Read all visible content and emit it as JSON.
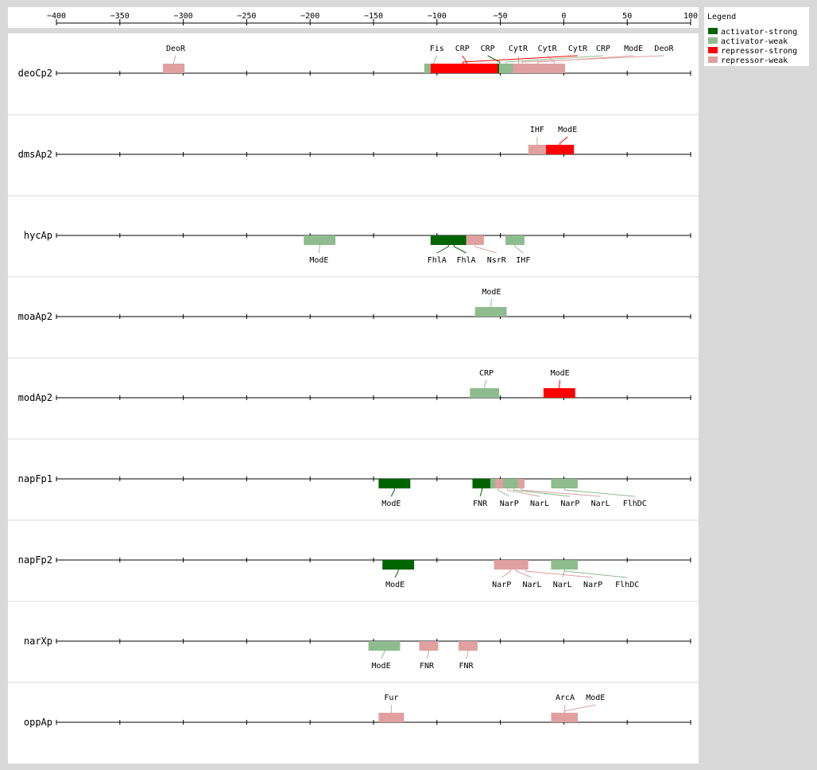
{
  "chart_data": {
    "type": "promoter-map",
    "axis": {
      "min": -400,
      "max": 100,
      "ticks": [
        -400,
        -350,
        -300,
        -250,
        -200,
        -150,
        -100,
        -50,
        0,
        50,
        100
      ],
      "tick_labels": [
        "−400",
        "−350",
        "−300",
        "−250",
        "−200",
        "−150",
        "−100",
        "−50",
        "0",
        "50",
        "100"
      ]
    },
    "colors": {
      "activator-strong": "#006400",
      "activator-weak": "#8fbc8f",
      "repressor-strong": "#ff0000",
      "repressor-weak": "#e0a0a0"
    },
    "legend": {
      "title": "Legend",
      "items": [
        {
          "key": "activator-strong",
          "label": "activator-strong"
        },
        {
          "key": "activator-weak",
          "label": "activator-weak"
        },
        {
          "key": "repressor-strong",
          "label": "repressor-strong"
        },
        {
          "key": "repressor-weak",
          "label": "repressor-weak"
        }
      ]
    },
    "tracks": [
      {
        "name": "deoCp2",
        "sites": [
          {
            "name": "DeoR",
            "start": -316,
            "end": -299,
            "type": "repressor-weak",
            "side": "above",
            "label_x": -306
          },
          {
            "name": "Fis",
            "start": -110,
            "end": -95,
            "type": "activator-weak",
            "side": "above",
            "label_x": -100
          },
          {
            "name": "CRP",
            "start": -105,
            "end": -48,
            "type": "repressor-strong",
            "side": "above",
            "label_x": -80
          },
          {
            "name": "CRP",
            "start": -52,
            "end": -49,
            "type": "activator-strong",
            "side": "above",
            "label_x": -60
          },
          {
            "name": "CytR",
            "start": -49,
            "end": -22,
            "type": "repressor-weak",
            "side": "above",
            "label_x": -36
          },
          {
            "name": "CytR",
            "start": -16,
            "end": 1,
            "type": "repressor-weak",
            "side": "above",
            "label_x": -13
          },
          {
            "name": "CytR",
            "start": -97,
            "end": -62,
            "type": "repressor-strong",
            "side": "above",
            "label_x": 11
          },
          {
            "name": "CRP",
            "start": -51,
            "end": -40,
            "type": "activator-weak",
            "side": "above",
            "label_x": 31
          },
          {
            "name": "ModE",
            "start": -30,
            "end": -11,
            "type": "repressor-weak",
            "side": "above",
            "label_x": 55
          },
          {
            "name": "DeoR",
            "start": -40,
            "end": -25,
            "type": "repressor-weak",
            "side": "above",
            "label_x": 79
          }
        ]
      },
      {
        "name": "dmsAp2",
        "sites": [
          {
            "name": "IHF",
            "start": -28,
            "end": -14,
            "type": "repressor-weak",
            "side": "above",
            "label_x": -21
          },
          {
            "name": "ModE",
            "start": -14,
            "end": 8,
            "type": "repressor-strong",
            "side": "above",
            "label_x": 3
          }
        ]
      },
      {
        "name": "hycAp",
        "sites": [
          {
            "name": "ModE",
            "start": -205,
            "end": -180,
            "type": "activator-weak",
            "side": "below",
            "label_x": -193
          },
          {
            "name": "FhlA",
            "start": -105,
            "end": -77,
            "type": "activator-strong",
            "side": "below",
            "label_x": -100
          },
          {
            "name": "FhlA",
            "start": -94,
            "end": -79,
            "type": "activator-strong",
            "side": "below",
            "label_x": -77
          },
          {
            "name": "NsrR",
            "start": -77,
            "end": -63,
            "type": "repressor-weak",
            "side": "below",
            "label_x": -53
          },
          {
            "name": "IHF",
            "start": -46,
            "end": -31,
            "type": "activator-weak",
            "side": "below",
            "label_x": -32
          }
        ]
      },
      {
        "name": "moaAp2",
        "sites": [
          {
            "name": "ModE",
            "start": -70,
            "end": -45,
            "type": "activator-weak",
            "side": "above",
            "label_x": -57
          }
        ]
      },
      {
        "name": "modAp2",
        "sites": [
          {
            "name": "CRP",
            "start": -74,
            "end": -51,
            "type": "activator-weak",
            "side": "above",
            "label_x": -61
          },
          {
            "name": "ModE",
            "start": -16,
            "end": 9,
            "type": "repressor-strong",
            "side": "above",
            "label_x": -3
          }
        ]
      },
      {
        "name": "napFp1",
        "sites": [
          {
            "name": "ModE",
            "start": -146,
            "end": -121,
            "type": "activator-strong",
            "side": "below",
            "label_x": -136
          },
          {
            "name": "FNR",
            "start": -72,
            "end": -57,
            "type": "activator-strong",
            "side": "below",
            "label_x": -66
          },
          {
            "name": "NarP",
            "start": -58,
            "end": -46,
            "type": "activator-weak",
            "side": "below",
            "label_x": -43
          },
          {
            "name": "NarL",
            "start": -54,
            "end": -35,
            "type": "repressor-weak",
            "side": "below",
            "label_x": -19
          },
          {
            "name": "NarP",
            "start": -48,
            "end": -31,
            "type": "activator-weak",
            "side": "below",
            "label_x": 5
          },
          {
            "name": "NarL",
            "start": -36,
            "end": -31,
            "type": "repressor-weak",
            "side": "below",
            "label_x": 29
          },
          {
            "name": "FlhDC",
            "start": -10,
            "end": 11,
            "type": "activator-weak",
            "side": "below",
            "label_x": 56
          }
        ]
      },
      {
        "name": "napFp2",
        "sites": [
          {
            "name": "ModE",
            "start": -143,
            "end": -118,
            "type": "activator-strong",
            "side": "below",
            "label_x": -133
          },
          {
            "name": "NarP",
            "start": -55,
            "end": -29,
            "type": "repressor-weak",
            "side": "below",
            "label_x": -49
          },
          {
            "name": "NarL",
            "start": -45,
            "end": -30,
            "type": "repressor-weak",
            "side": "below",
            "label_x": -25
          },
          {
            "name": "NarL",
            "start": -10,
            "end": 11,
            "type": "activator-weak",
            "side": "below",
            "label_x": -1
          },
          {
            "name": "NarP",
            "start": -32,
            "end": -28,
            "type": "repressor-weak",
            "side": "below",
            "label_x": 23
          },
          {
            "name": "FlhDC",
            "start": -10,
            "end": 11,
            "type": "activator-weak",
            "side": "below",
            "label_x": 50
          }
        ]
      },
      {
        "name": "narXp",
        "sites": [
          {
            "name": "ModE",
            "start": -154,
            "end": -129,
            "type": "activator-weak",
            "side": "below",
            "label_x": -144
          },
          {
            "name": "FNR",
            "start": -114,
            "end": -99,
            "type": "repressor-weak",
            "side": "below",
            "label_x": -108
          },
          {
            "name": "FNR",
            "start": -83,
            "end": -68,
            "type": "repressor-weak",
            "side": "below",
            "label_x": -77
          }
        ]
      },
      {
        "name": "oppAp",
        "sites": [
          {
            "name": "Fur",
            "start": -146,
            "end": -126,
            "type": "repressor-weak",
            "side": "above",
            "label_x": -136
          },
          {
            "name": "ArcA",
            "start": -10,
            "end": 11,
            "type": "repressor-weak",
            "side": "above",
            "label_x": 1
          },
          {
            "name": "ModE",
            "start": -10,
            "end": 11,
            "type": "repressor-weak",
            "side": "above",
            "label_x": 25
          }
        ]
      }
    ]
  }
}
